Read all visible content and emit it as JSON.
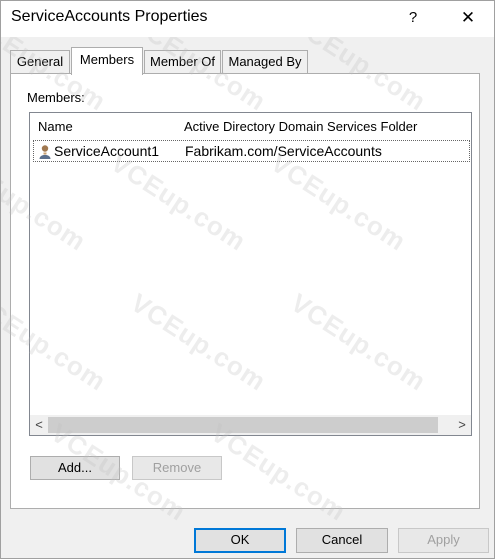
{
  "window": {
    "title": "ServiceAccounts Properties",
    "help_glyph": "?",
    "close_glyph": "✕"
  },
  "tabs": [
    {
      "label": "General",
      "active": false
    },
    {
      "label": "Members",
      "active": true
    },
    {
      "label": "Member Of",
      "active": false
    },
    {
      "label": "Managed By",
      "active": false
    }
  ],
  "members": {
    "label": "Members:",
    "columns": [
      "Name",
      "Active Directory Domain Services Folder"
    ],
    "rows": [
      {
        "name": "ServiceAccount1",
        "folder": "Fabrikam.com/ServiceAccounts",
        "icon": "user-icon"
      }
    ],
    "scroll_left": "<",
    "scroll_right": ">"
  },
  "buttons": {
    "add": "Add...",
    "remove": "Remove",
    "ok": "OK",
    "cancel": "Cancel",
    "apply": "Apply"
  },
  "watermark_text": "VCEup.com",
  "colors": {
    "focus_border": "#0078d7",
    "disabled_text": "#a0a0a0"
  }
}
